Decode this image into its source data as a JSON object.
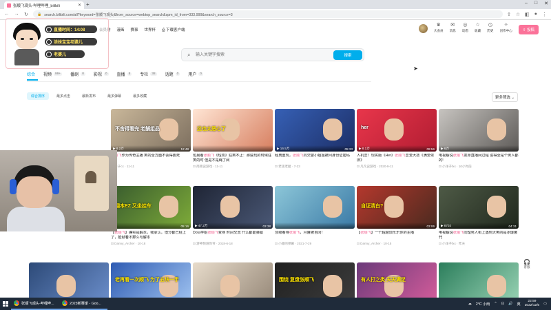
{
  "browser": {
    "tab_title": "张顺飞观头-哔哩哔哩_bilibili",
    "url": "search.bilibili.com/all?keyword=张顺飞观头&from_source=webtop_search&spm_id_from=333.999&search_source=3"
  },
  "topnav": [
    "会员购",
    "漫画",
    "赛事",
    "世界杯",
    "下载客户端"
  ],
  "rightnav": [
    "大会员",
    "消息",
    "动态",
    "收藏",
    "历史",
    "创作中心"
  ],
  "upload_label": "投稿",
  "overlay": {
    "time_label": "直播时间：14:08",
    "pill2": "涂妹宝宝老婆儿",
    "pill3": "老婆儿"
  },
  "search": {
    "placeholder": "输入关键字搜索",
    "button": "搜索"
  },
  "type_tabs": [
    {
      "label": "综合",
      "count": ""
    },
    {
      "label": "视频",
      "count": "99+"
    },
    {
      "label": "番剧",
      "count": "0"
    },
    {
      "label": "影视",
      "count": "0"
    },
    {
      "label": "直播",
      "count": "5"
    },
    {
      "label": "专栏",
      "count": "38"
    },
    {
      "label": "话题",
      "count": "0"
    },
    {
      "label": "用户",
      "count": "0"
    }
  ],
  "sort": [
    "综合排序",
    "最多点击",
    "最新发布",
    "最多弹幕",
    "最多收藏"
  ],
  "more_filter": "更多筛选",
  "videos": [
    {
      "views": "6.7万",
      "dur": "05:33",
      "title_a": "",
      "title_hl": "",
      "title_b": "",
      "author": "",
      "caption": ""
    },
    {
      "views": "8.2万",
      "dur": "12:48",
      "title_a": "",
      "title_hl": "张顺飞",
      "title_b": "作为传奇主播 笑的全方面不会得要死",
      "author": "亦于cc · 11-11",
      "caption": "不舍得看完 老舗组品"
    },
    {
      "views": "",
      "dur": "",
      "title_a": "包晨看",
      "title_hl": "张顺飞",
      "title_b": "《短攻》狂笑不止：那些玩的时候狂笑的时 但是不是绳了间",
      "author": "南南说游戏 · 11-11",
      "caption": "这也太恶心了"
    },
    {
      "views": "16.5万",
      "dur": "05:33",
      "title_a": "经典重现，",
      "title_hl": "张顺飞",
      "title_b": "同交警小姐姐被问身份证密码",
      "author": "老镁老腿 · 7-23",
      "caption": ""
    },
    {
      "views": "8.1万",
      "dur": "09:56",
      "title_a": "人机恋！现实版《Her》",
      "title_hl": "张顺飞",
      "title_b": "恋爱大技《满爱依旧》",
      "author": "凡凡说游戏 · 2020-9-11",
      "caption": "her"
    },
    {
      "views": "6万",
      "dur": "",
      "title_a": "电视解说",
      "title_hl": "张顺飞",
      "title_b": "变身直播间过程 说得全是个男人都的!",
      "author": "小洋子fxx · 10小时前",
      "caption": ""
    },
    {
      "views": "",
      "dur": "",
      "title_a": "飞月大锅事件后，半月后重返",
      "title_hl": "张顺飞",
      "title_b": "，我和张顺飞一起之后的",
      "author": "小顺的弹幕 · 2021-10-13",
      "caption": ""
    },
    {
      "views": "",
      "dur": "05:16",
      "title_a": "【",
      "title_hl": "张顺飞",
      "title_b": "】确实是解本，我承认，但分都已经上了，脸就看不那么与解本",
      "author": "Danny_Archer · 10-18",
      "caption": "翻本EZ 又坐挂车"
    },
    {
      "views": "47.2万",
      "dur": "03:38",
      "title_a": "Dota学姐",
      "title_hl": "张顺飞",
      "title_b": "变身 时间交流 什么都能弹幕",
      "author": "游神频道你爷 · 2018-6-18",
      "caption": ""
    },
    {
      "views": "",
      "dur": "",
      "title_a": "顶级看待",
      "title_hl": "张顺飞",
      "title_b": "，月度被自闭！",
      "author": "小顺的弹幕 · 2021-7-29",
      "caption": ""
    },
    {
      "views": "",
      "dur": "03:06",
      "title_a": "【",
      "title_hl": "张顺飞",
      "title_b": "】一个超越烦乐乐你的主播",
      "author": "Danny_Archer · 10-15",
      "caption": "自证清白?"
    },
    {
      "views": "8702",
      "dur": "04:31",
      "title_a": "电视解说",
      "title_hl": "张顺飞",
      "title_b": "同理男人街上遇到大笑的是冰爆傲代",
      "author": "小洋子fxx · 昨天",
      "caption": ""
    },
    {
      "views": "",
      "dur": "",
      "title_a": "",
      "title_hl": "",
      "title_b": "",
      "author": "",
      "caption": ""
    },
    {
      "views": "",
      "dur": "",
      "title_a": "",
      "title_hl": "",
      "title_b": "",
      "author": "",
      "caption": "老再看一次顺飞 为了五块一手"
    },
    {
      "views": "",
      "dur": "",
      "title_a": "",
      "title_hl": "",
      "title_b": "",
      "author": "",
      "caption": ""
    },
    {
      "views": "",
      "dur": "",
      "title_a": "",
      "title_hl": "",
      "title_b": "",
      "author": "",
      "caption": "围绕 复盘张顺飞"
    },
    {
      "views": "",
      "dur": "",
      "title_a": "",
      "title_hl": "",
      "title_b": "",
      "author": "",
      "caption": "有人打之类 天天满足"
    },
    {
      "views": "",
      "dur": "",
      "title_a": "",
      "title_hl": "",
      "title_b": "",
      "author": "",
      "caption": ""
    }
  ],
  "sideicon_label": "客服",
  "taskbar": {
    "app1": "张顺飞观头-哔哩哔...",
    "app2": "2023新赛季 - Goo...",
    "weather": "2°C 小雨",
    "time": "22:59",
    "date": "2022/12/5",
    "lang": "英"
  },
  "colors": {
    "accent": "#00aeec",
    "pink": "#fb7299",
    "highlight": "#f25d8e"
  }
}
